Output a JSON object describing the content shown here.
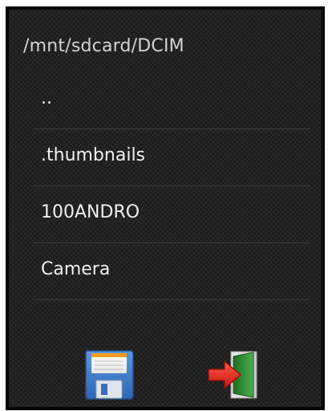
{
  "header": {
    "path": "/mnt/sdcard/DCIM"
  },
  "file_list": {
    "items": [
      {
        "label": ".."
      },
      {
        "label": ".thumbnails"
      },
      {
        "label": "100ANDRO"
      },
      {
        "label": "Camera"
      }
    ]
  },
  "toolbar": {
    "buttons": [
      {
        "icon": "floppy-disk-save-icon"
      },
      {
        "icon": "exit-door-icon"
      }
    ]
  },
  "colors": {
    "floppy_blue": "#3b78c9",
    "exit_arrow_red": "#e2231a",
    "door_green": "#2d8a2f"
  }
}
